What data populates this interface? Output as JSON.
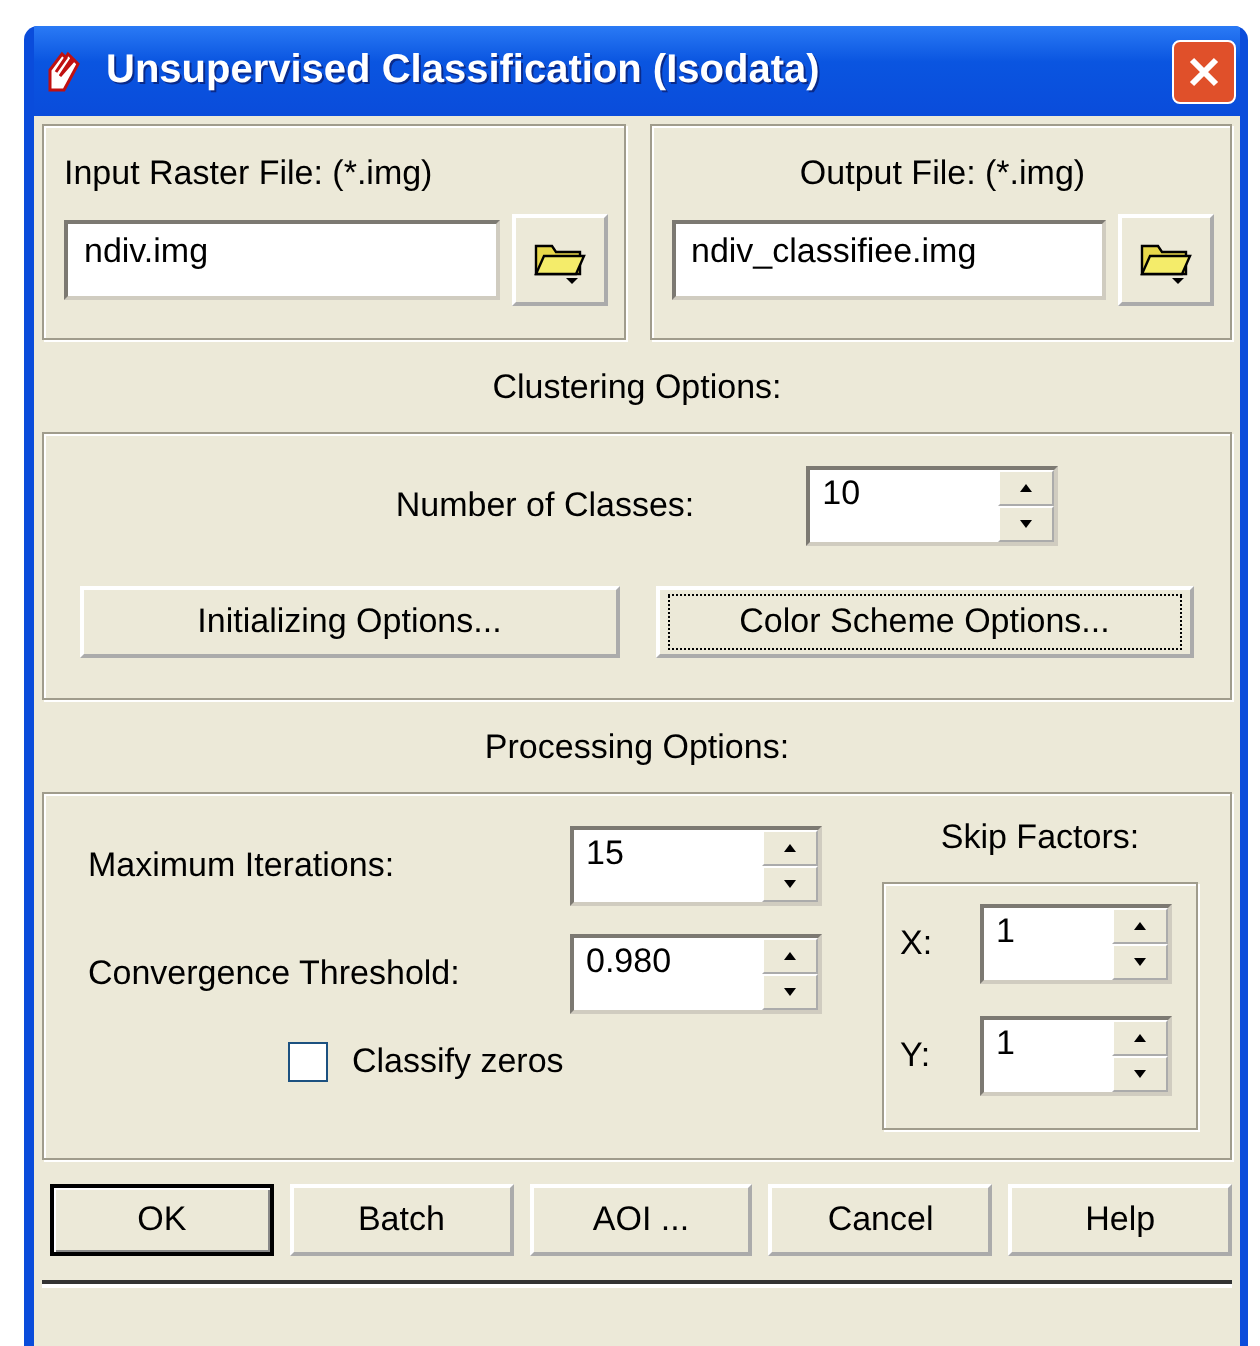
{
  "window": {
    "title": "Unsupervised Classification (Isodata)"
  },
  "input_file": {
    "label": "Input Raster File: (*.img)",
    "value": "ndiv.img"
  },
  "output_file": {
    "label": "Output File: (*.img)",
    "value": "ndiv_classifiee.img"
  },
  "clustering": {
    "heading": "Clustering Options:",
    "classes_label": "Number of Classes:",
    "classes_value": "10",
    "buttons": [
      {
        "label": "Initializing Options...",
        "focused": false
      },
      {
        "label": "Color Scheme Options...",
        "focused": true
      }
    ]
  },
  "processing": {
    "heading": "Processing Options:",
    "max_iterations_label": "Maximum Iterations:",
    "max_iterations_value": "15",
    "threshold_label": "Convergence Threshold:",
    "threshold_value": "0.980",
    "classify_zeros": {
      "label": "Classify zeros",
      "checked": false
    },
    "skip_factors": {
      "heading": "Skip Factors:",
      "x_label": "X:",
      "x_value": "1",
      "y_label": "Y:",
      "y_value": "1"
    }
  },
  "buttons": [
    {
      "label": "OK",
      "default": true
    },
    {
      "label": "Batch",
      "default": false
    },
    {
      "label": "AOI ...",
      "default": false
    },
    {
      "label": "Cancel",
      "default": false
    },
    {
      "label": "Help",
      "default": false
    }
  ]
}
